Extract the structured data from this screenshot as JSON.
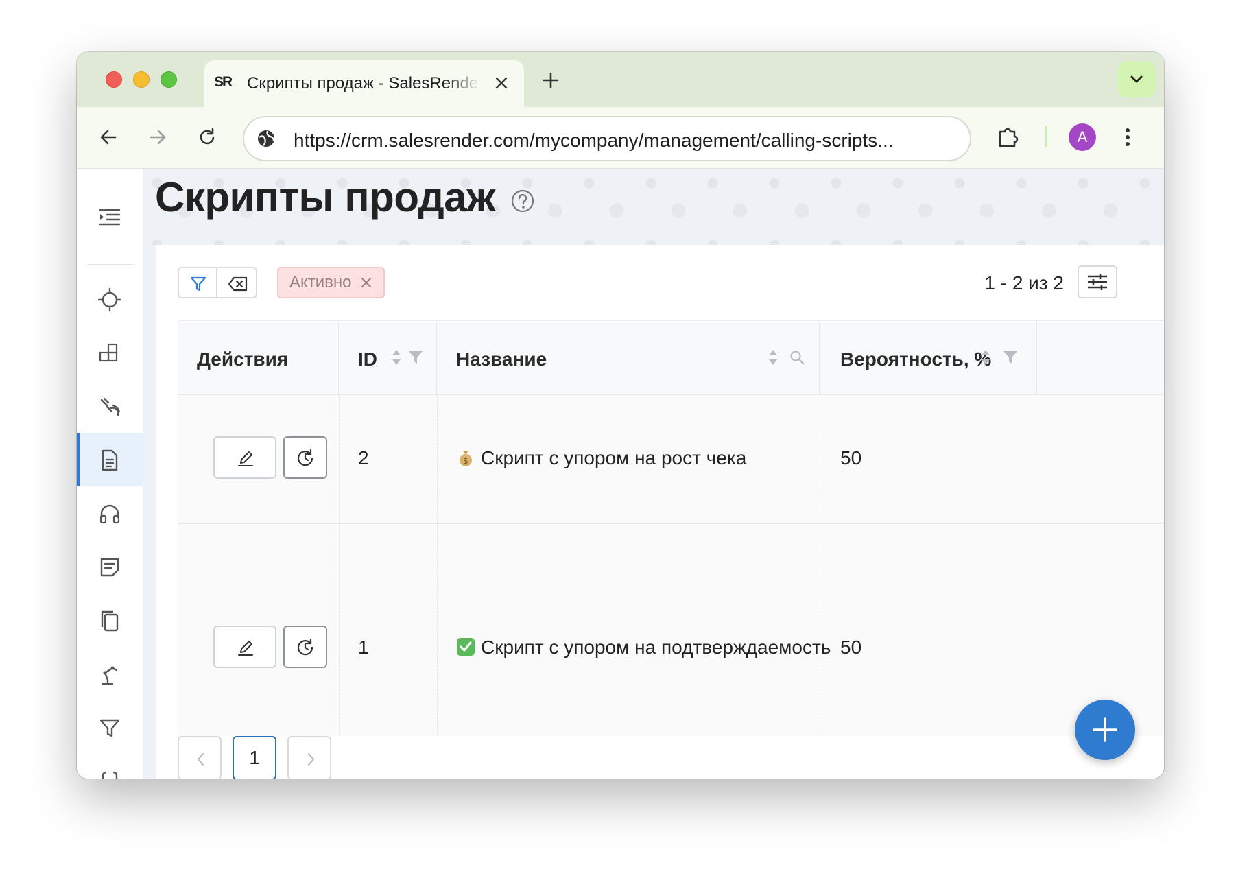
{
  "browser": {
    "tab": {
      "favicon_text": "SR",
      "title": "Скрипты продаж - SalesRender"
    },
    "url": "https://crm.salesrender.com/mycompany/management/calling-scripts...",
    "profile_initial": "A"
  },
  "page": {
    "title": "Скрипты продаж"
  },
  "toolbar": {
    "active_filter_chip": "Активно",
    "counter": "1 - 2 из 2"
  },
  "table": {
    "columns": [
      {
        "label": "Действия"
      },
      {
        "label": "ID"
      },
      {
        "label": "Название"
      },
      {
        "label": "Вероятность, %"
      }
    ],
    "rows": [
      {
        "id": "2",
        "emoji": "money-bag",
        "name": "Скрипт с упором на рост чека",
        "probability": "50"
      },
      {
        "id": "1",
        "emoji": "check-mark",
        "name": "Скрипт с упором на подтверждаемость",
        "probability": "50"
      }
    ]
  },
  "pagination": {
    "current_page": "1"
  },
  "sidebar": {
    "items": [
      {
        "icon": "menu-collapse-icon"
      },
      {
        "icon": "crosshair-icon"
      },
      {
        "icon": "boxes-icon"
      },
      {
        "icon": "satellite-icon"
      },
      {
        "icon": "document-icon",
        "active": true
      },
      {
        "icon": "headphones-icon"
      },
      {
        "icon": "note-icon"
      },
      {
        "icon": "copy-icon"
      },
      {
        "icon": "robot-arm-icon"
      },
      {
        "icon": "funnel-icon"
      },
      {
        "icon": "braces-icon"
      }
    ]
  },
  "colors": {
    "accent": "#2f7bcf",
    "chip_bg": "#fbe1e1",
    "tabstrip_bg": "#dfe9d6",
    "avatar_bg": "#a347c6"
  }
}
